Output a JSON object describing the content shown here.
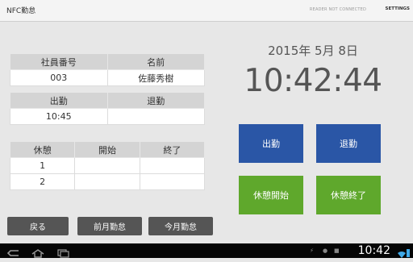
{
  "titlebar": {
    "app_title": "NFC勤怠",
    "reader_status": "READER NOT CONNECTED",
    "settings_label": "SETTINGS"
  },
  "employee": {
    "headers": [
      "社員番号",
      "名前"
    ],
    "values": [
      "003",
      "佐藤秀樹"
    ]
  },
  "attendance": {
    "headers": [
      "出勤",
      "退勤"
    ],
    "values": [
      "10:45",
      ""
    ]
  },
  "breaks": {
    "headers": [
      "休憩",
      "開始",
      "終了"
    ],
    "rows": [
      [
        "1",
        "",
        ""
      ],
      [
        "2",
        "",
        ""
      ]
    ]
  },
  "clock": {
    "date": "2015年  5月  8日",
    "time": "10:42:44"
  },
  "actions": {
    "clock_in": "出勤",
    "clock_out": "退勤",
    "break_start": "休憩開始",
    "break_end": "休憩終了"
  },
  "bottom_buttons": {
    "back": "戻る",
    "prev_month": "前月勤怠",
    "this_month": "今月勤怠"
  },
  "system_bar": {
    "time": "10:42"
  },
  "colors": {
    "blue_button": "#2a56a6",
    "green_button": "#5fa82c",
    "gray_button": "#555555"
  }
}
